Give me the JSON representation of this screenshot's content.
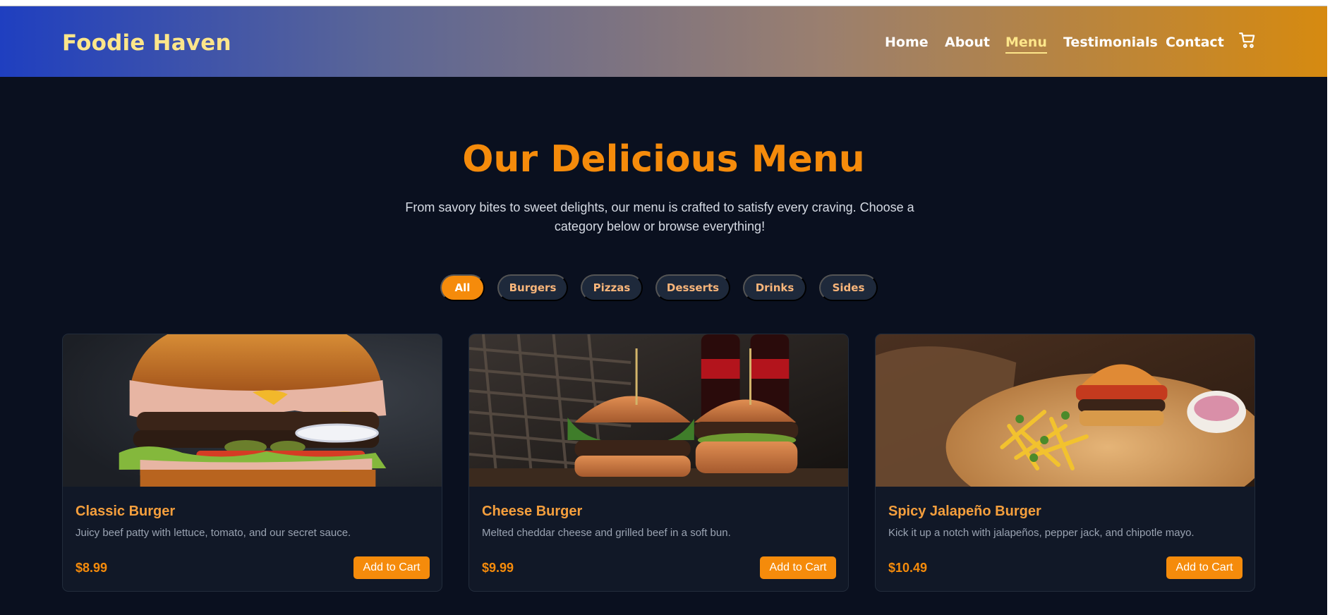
{
  "brand": {
    "name": "Foodie Haven"
  },
  "nav": {
    "items": [
      {
        "label": "Home",
        "active": false
      },
      {
        "label": "About",
        "active": false
      },
      {
        "label": "Menu",
        "active": true
      },
      {
        "label": "Testimonials",
        "active": false
      },
      {
        "label": "Contact",
        "active": false
      }
    ],
    "cart_icon": "cart-icon"
  },
  "hero": {
    "title": "Our Delicious Menu",
    "subtitle": "From savory bites to sweet delights, our menu is crafted to satisfy every craving. Choose a category below or browse everything!"
  },
  "filters": [
    {
      "label": "All",
      "active": true
    },
    {
      "label": "Burgers",
      "active": false
    },
    {
      "label": "Pizzas",
      "active": false
    },
    {
      "label": "Desserts",
      "active": false
    },
    {
      "label": "Drinks",
      "active": false
    },
    {
      "label": "Sides",
      "active": false
    }
  ],
  "menu_items": [
    {
      "name": "Classic Burger",
      "description": "Juicy beef patty with lettuce, tomato, and our secret sauce.",
      "price": "$8.99",
      "button": "Add to Cart",
      "image": "double-cheeseburger-photo"
    },
    {
      "name": "Cheese Burger",
      "description": "Melted cheddar cheese and grilled beef in a soft bun.",
      "price": "$9.99",
      "button": "Add to Cart",
      "image": "two-burgers-with-cola-photo"
    },
    {
      "name": "Spicy Jalapeño Burger",
      "description": "Kick it up a notch with jalapeños, pepper jack, and chipotle mayo.",
      "price": "$10.49",
      "button": "Add to Cart",
      "image": "burger-with-fries-and-coleslaw-photo"
    }
  ],
  "colors": {
    "page_bg": "#0a101f",
    "accent": "#f58b0b",
    "brand_yellow": "#fde68a",
    "card_bg": "#111827",
    "chip_bg": "#1e293b"
  }
}
